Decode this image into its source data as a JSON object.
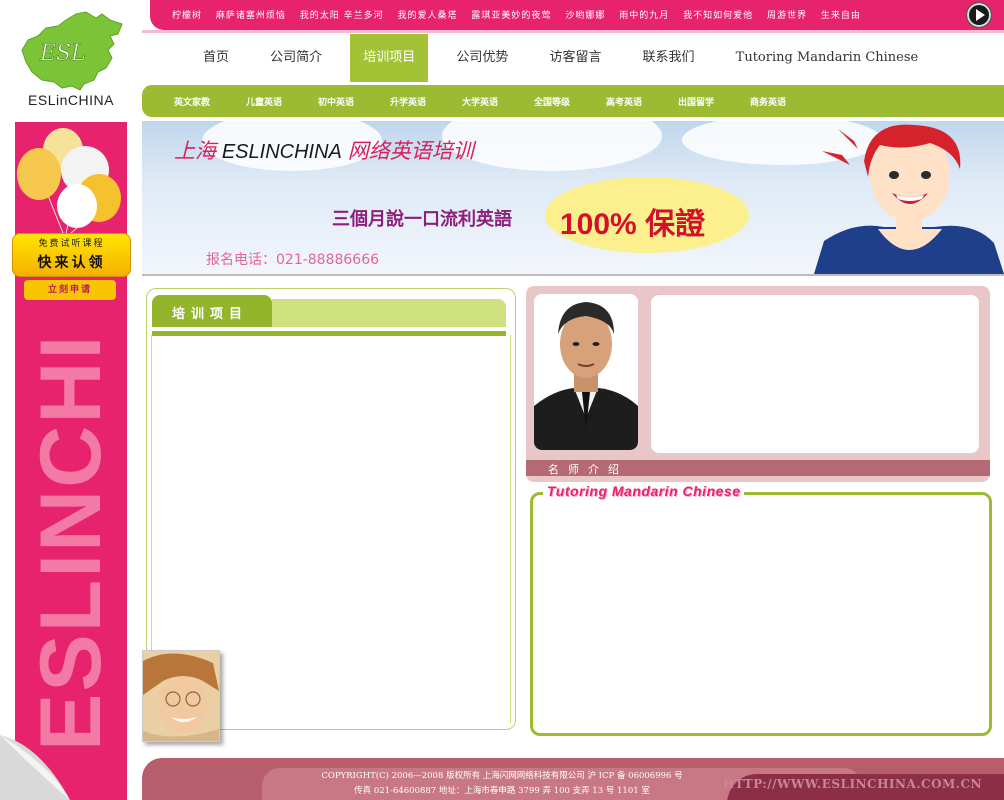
{
  "logo": {
    "badge_text": "ESL",
    "text": "ESLinCHINA"
  },
  "songbar": {
    "songs": [
      "柠檬树",
      "麻萨诸塞州烦恼",
      "我的太阳 辛兰多河",
      "我的爱人桑塔",
      "露琪亚美妙的夜莺",
      "沙哟娜娜",
      "雨中的九月",
      "我不知如何爱他",
      "周游世界",
      "生来自由"
    ],
    "play_icon": "play-icon"
  },
  "nav": {
    "items": [
      "首页",
      "公司简介",
      "培训项目",
      "公司优势",
      "访客留言",
      "联系我们",
      "Tutoring Mandarin Chinese"
    ],
    "active_index": 2
  },
  "subnav": {
    "items": [
      "英文家教",
      "儿童英语",
      "初中英语",
      "升学英语",
      "大学英语",
      "全国等级",
      "高考英语",
      "出国留学",
      "商务英语"
    ]
  },
  "sidebar": {
    "promo_top": "免费试听课程",
    "promo_main": "快来认领",
    "apply_label": "立刻申请",
    "vertical_brand": "ESLINCHI"
  },
  "banner": {
    "title_city": "上海",
    "title_brand": "ESLINCHINA",
    "title_rest": "网络英语培训",
    "slogan": "三個月說一口流利英語",
    "badge": "100% 保證",
    "phone": "报名电话：021-88886666"
  },
  "training": {
    "title": "培训项目"
  },
  "teacher": {
    "label": "名师介绍"
  },
  "mandarin": {
    "title": "Tutoring Mandarin Chinese"
  },
  "footer": {
    "copyright": "COPYRIGHT(C) 2006—2008 版权所有 上海闪网网络科技有限公司 沪 ICP 备 06006996 号",
    "contact": "传真 021-64600887 地址：上海市春申路 3799 弄 100 支弄 13 号 1101 室",
    "url": "HTTP://WWW.ESLINCHINA.COM.CN"
  },
  "colors": {
    "pink": "#e8236d",
    "green": "#9cba32",
    "footer": "#b85d6b"
  }
}
